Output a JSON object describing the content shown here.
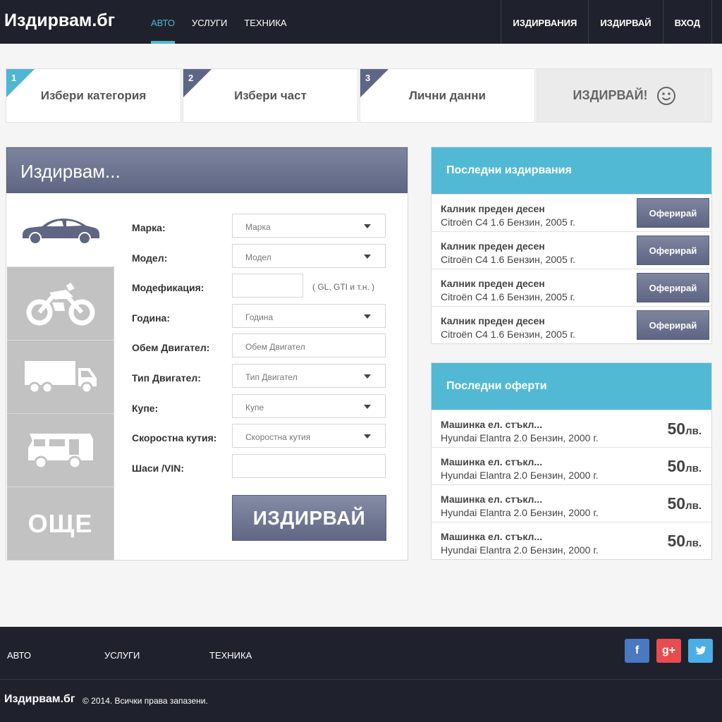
{
  "header": {
    "logo": "Издирвам.бг",
    "nav": [
      "АВТО",
      "УСЛУГИ",
      "ТЕХНИКА"
    ],
    "right_nav": [
      "ИЗДИРВАНИЯ",
      "ИЗДИРВАЙ",
      "ВХОД"
    ]
  },
  "steps": [
    {
      "num": "1",
      "label": "Избери категория"
    },
    {
      "num": "2",
      "label": "Избери част"
    },
    {
      "num": "3",
      "label": "Лични данни"
    },
    {
      "label": "ИЗДИРВАЙ!"
    }
  ],
  "search": {
    "title": "Издирвам...",
    "categories": {
      "more": "ОЩЕ"
    },
    "fields": [
      {
        "label": "Марка:",
        "value": "Марка"
      },
      {
        "label": "Модел:",
        "value": "Модел"
      },
      {
        "label": "Модефикация:",
        "value": "",
        "hint": "( GL, GTI и т.н. )"
      },
      {
        "label": "Година:",
        "value": "Година"
      },
      {
        "label": "Обем Двигател:",
        "value": "Обем Двигател"
      },
      {
        "label": "Тип Двигател:",
        "value": "Тип Двигател"
      },
      {
        "label": "Купе:",
        "value": "Купе"
      },
      {
        "label": "Скоростна кутия:",
        "value": "Скоростна кутия"
      },
      {
        "label": "Шаси /VIN:",
        "value": ""
      }
    ],
    "button": "ИЗДИРВАЙ"
  },
  "searches": {
    "title": "Последни издирвания",
    "button": "Оферирай",
    "items": [
      {
        "title": "Калник преден десен",
        "sub": "Citroën C4 1.6 Бензин, 2005 г."
      },
      {
        "title": "Калник преден десен",
        "sub": "Citroën C4 1.6 Бензин, 2005 г."
      },
      {
        "title": "Калник преден десен",
        "sub": "Citroën C4 1.6 Бензин, 2005 г."
      },
      {
        "title": "Калник преден десен",
        "sub": "Citroën C4 1.6 Бензин, 2005 г."
      }
    ]
  },
  "offers": {
    "title": "Последни оферти",
    "items": [
      {
        "title": "Машинка ел. стъкл...",
        "sub": "Hyundai Elantra 2.0 Бензин, 2000 г.",
        "price": "50",
        "currency": "лв."
      },
      {
        "title": "Машинка ел. стъкл...",
        "sub": "Hyundai Elantra 2.0 Бензин, 2000 г.",
        "price": "50",
        "currency": "лв."
      },
      {
        "title": "Машинка ел. стъкл...",
        "sub": "Hyundai Elantra 2.0 Бензин, 2000 г.",
        "price": "50",
        "currency": "лв."
      },
      {
        "title": "Машинка ел. стъкл...",
        "sub": "Hyundai Elantra 2.0 Бензин, 2000 г.",
        "price": "50",
        "currency": "лв."
      }
    ]
  },
  "footer": {
    "nav": [
      "АВТО",
      "УСЛУГИ",
      "ТЕХНИКА"
    ],
    "social": [
      {
        "name": "facebook",
        "glyph": "f",
        "color": "#4a78c1"
      },
      {
        "name": "google-plus",
        "glyph": "g+",
        "color": "#e84c4f"
      },
      {
        "name": "twitter",
        "glyph": "t",
        "color": "#4aafe6"
      }
    ],
    "logo": "Издирвам.бг",
    "copyright": "© 2014. Всички права запазени."
  },
  "colors": {
    "accent": "#52b9d4",
    "dark": "#1f222d",
    "button": "#5e6683"
  }
}
